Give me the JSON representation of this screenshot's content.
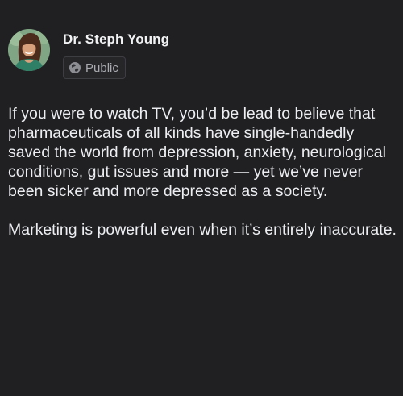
{
  "post": {
    "author": "Dr. Steph Young",
    "privacy_label": "Public",
    "paragraphs": [
      "If you were to watch TV, you’d be lead to believe that pharmaceuticals of all kinds have single-handedly saved the world from depression, anxiety, neurological conditions, gut issues and more — yet we’ve never been sicker and more depressed as a society.",
      "Marketing is powerful even when it’s entirely inaccurate."
    ]
  },
  "icons": {
    "privacy": "globe-icon",
    "author_photo": "avatar"
  },
  "colors": {
    "background": "#202022",
    "text": "#eceef2",
    "muted": "#a9abb0"
  }
}
